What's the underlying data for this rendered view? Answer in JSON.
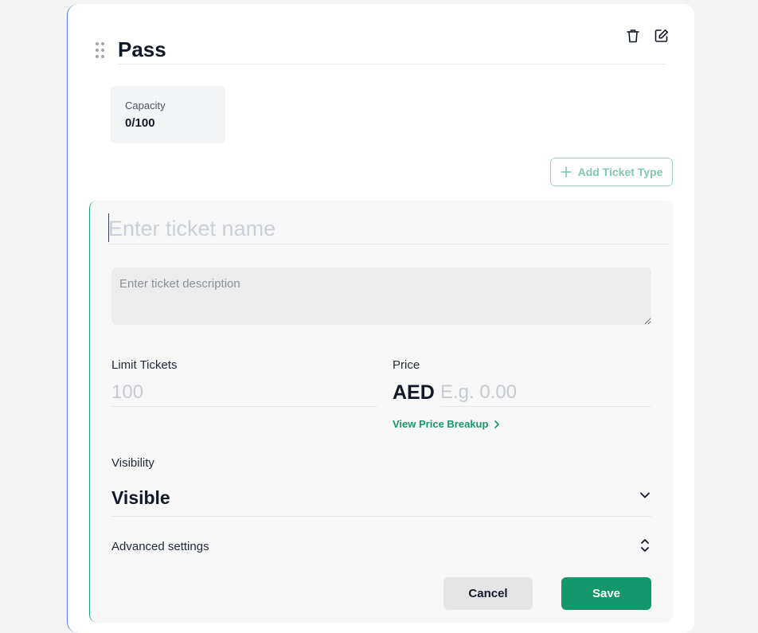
{
  "pass": {
    "title": "Pass",
    "capacity_label": "Capacity",
    "capacity_value": "0/100"
  },
  "toolbar": {
    "delete_icon": "trash-icon",
    "edit_icon": "edit-icon"
  },
  "add_ticket_type_label": "Add Ticket Type",
  "ticket_form": {
    "name_placeholder": "Enter ticket name",
    "description_placeholder": "Enter ticket description",
    "limit_label": "Limit Tickets",
    "limit_placeholder": "100",
    "price_label": "Price",
    "currency": "AED",
    "price_placeholder": "E.g. 0.00",
    "price_breakup_link": "View Price Breakup",
    "visibility_label": "Visibility",
    "visibility_value": "Visible",
    "advanced_settings_label": "Advanced settings",
    "cancel_label": "Cancel",
    "save_label": "Save"
  },
  "colors": {
    "accent_green": "#14976c",
    "accent_blue": "#4f7df0"
  }
}
